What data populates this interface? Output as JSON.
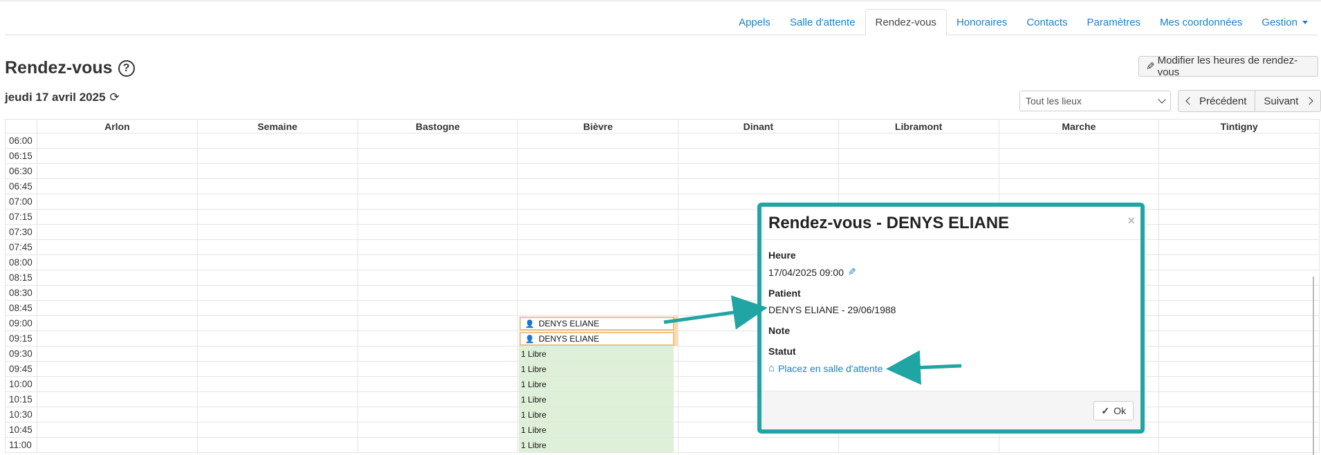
{
  "nav": {
    "tabs": [
      {
        "label": "Appels"
      },
      {
        "label": "Salle d'attente"
      },
      {
        "label": "Rendez-vous"
      },
      {
        "label": "Honoraires"
      },
      {
        "label": "Contacts"
      },
      {
        "label": "Paramètres"
      },
      {
        "label": "Mes coordonnées"
      },
      {
        "label": "Gestion"
      }
    ]
  },
  "header": {
    "title": "Rendez-vous",
    "help_icon": "question-circle-icon",
    "date": "jeudi 17 avril 2025",
    "refresh_icon": "refresh-icon",
    "modify_button": "Modifier les heures de rendez-vous",
    "location_select": "Tout les lieux",
    "prev_button": "Précédent",
    "next_button": "Suivant"
  },
  "calendar": {
    "columns": [
      "Arlon",
      "Semaine",
      "Bastogne",
      "Bièvre",
      "Dinant",
      "Libramont",
      "Marche",
      "Tintigny"
    ],
    "times": [
      "06:00",
      "06:15",
      "06:30",
      "06:45",
      "07:00",
      "07:15",
      "07:30",
      "07:45",
      "08:00",
      "08:15",
      "08:30",
      "08:45",
      "09:00",
      "09:15",
      "09:30",
      "09:45",
      "10:00",
      "10:15",
      "10:30",
      "10:45",
      "11:00"
    ],
    "appointments": [
      {
        "time": "09:00",
        "column": "Bièvre",
        "name": "DENYS ELIANE"
      },
      {
        "time": "09:15",
        "column": "Bièvre",
        "name": "DENYS ELIANE"
      }
    ],
    "free_slots": {
      "column": "Bièvre",
      "label": "1 Libre",
      "times": [
        "09:30",
        "09:45",
        "10:00",
        "10:15",
        "10:30",
        "10:45",
        "11:00"
      ]
    }
  },
  "modal": {
    "title": "Rendez-vous - DENYS ELIANE",
    "heure_label": "Heure",
    "heure_value": "17/04/2025 09:00",
    "patient_label": "Patient",
    "patient_value": "DENYS ELIANE - 29/06/1988",
    "note_label": "Note",
    "statut_label": "Statut",
    "statut_link": "Placez en salle d'attente",
    "ok_button": "Ok",
    "close_symbol": "×"
  },
  "colors": {
    "link": "#1a7fc6",
    "highlight_frame": "#21a5a4",
    "appointment_border": "#f0c27a",
    "free_slot": "#dff0d8"
  }
}
